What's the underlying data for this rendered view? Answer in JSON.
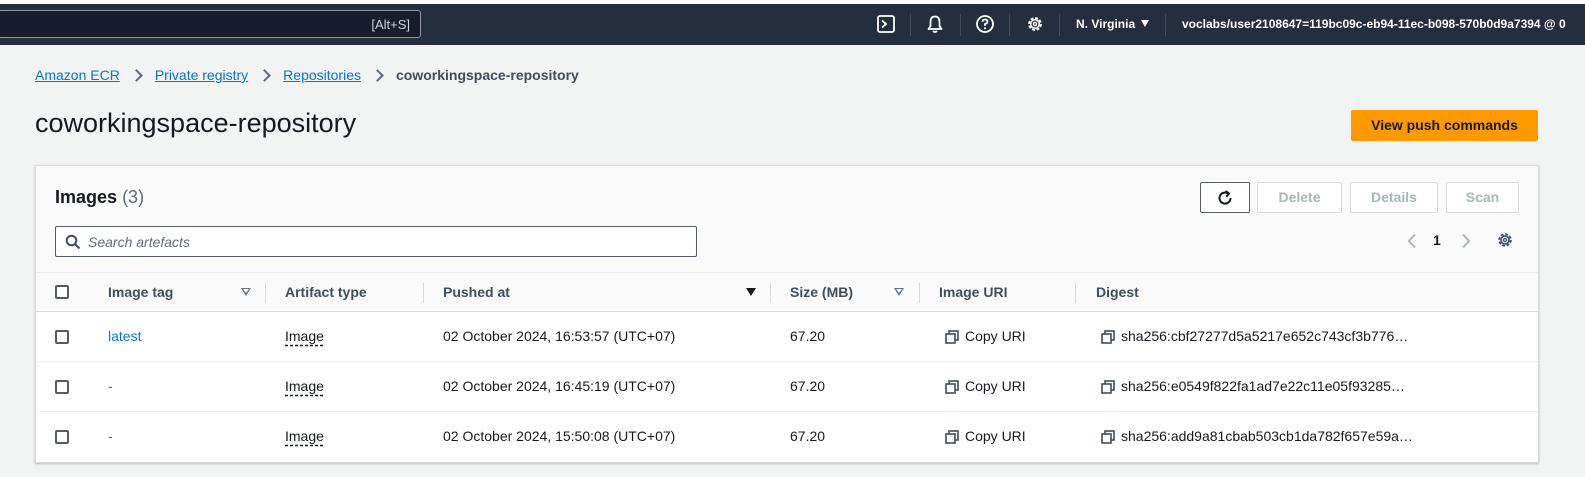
{
  "topbar": {
    "search_shortcut": "[Alt+S]",
    "region": "N. Virginia",
    "account": "voclabs/user2108647=119bc09c-eb94-11ec-b098-570b0d9a7394 @ 0"
  },
  "breadcrumb": {
    "items": [
      "Amazon ECR",
      "Private registry",
      "Repositories"
    ],
    "current": "coworkingspace-repository"
  },
  "page": {
    "title": "coworkingspace-repository",
    "primary_action": "View push commands"
  },
  "images": {
    "title": "Images",
    "count": "(3)",
    "actions": {
      "delete": "Delete",
      "details": "Details",
      "scan": "Scan"
    },
    "search_placeholder": "Search artefacts",
    "page": "1",
    "columns": [
      "Image tag",
      "Artifact type",
      "Pushed at",
      "Size (MB)",
      "Image URI",
      "Digest"
    ],
    "rows": [
      {
        "tag": "latest",
        "type": "Image",
        "pushed": "02 October 2024, 16:53:57 (UTC+07)",
        "size": "67.20",
        "uri": "Copy URI",
        "digest": "sha256:cbf27277d5a5217e652c743cf3b776…"
      },
      {
        "tag": "-",
        "type": "Image",
        "pushed": "02 October 2024, 16:45:19 (UTC+07)",
        "size": "67.20",
        "uri": "Copy URI",
        "digest": "sha256:e0549f822fa1ad7e22c11e05f93285…"
      },
      {
        "tag": "-",
        "type": "Image",
        "pushed": "02 October 2024, 15:50:08 (UTC+07)",
        "size": "67.20",
        "uri": "Copy URI",
        "digest": "sha256:add9a81cbab503cb1da782f657e59a…"
      }
    ]
  },
  "colors": {
    "topbar": "#232f3e",
    "primary": "#ff9900",
    "link": "#0972d3"
  }
}
